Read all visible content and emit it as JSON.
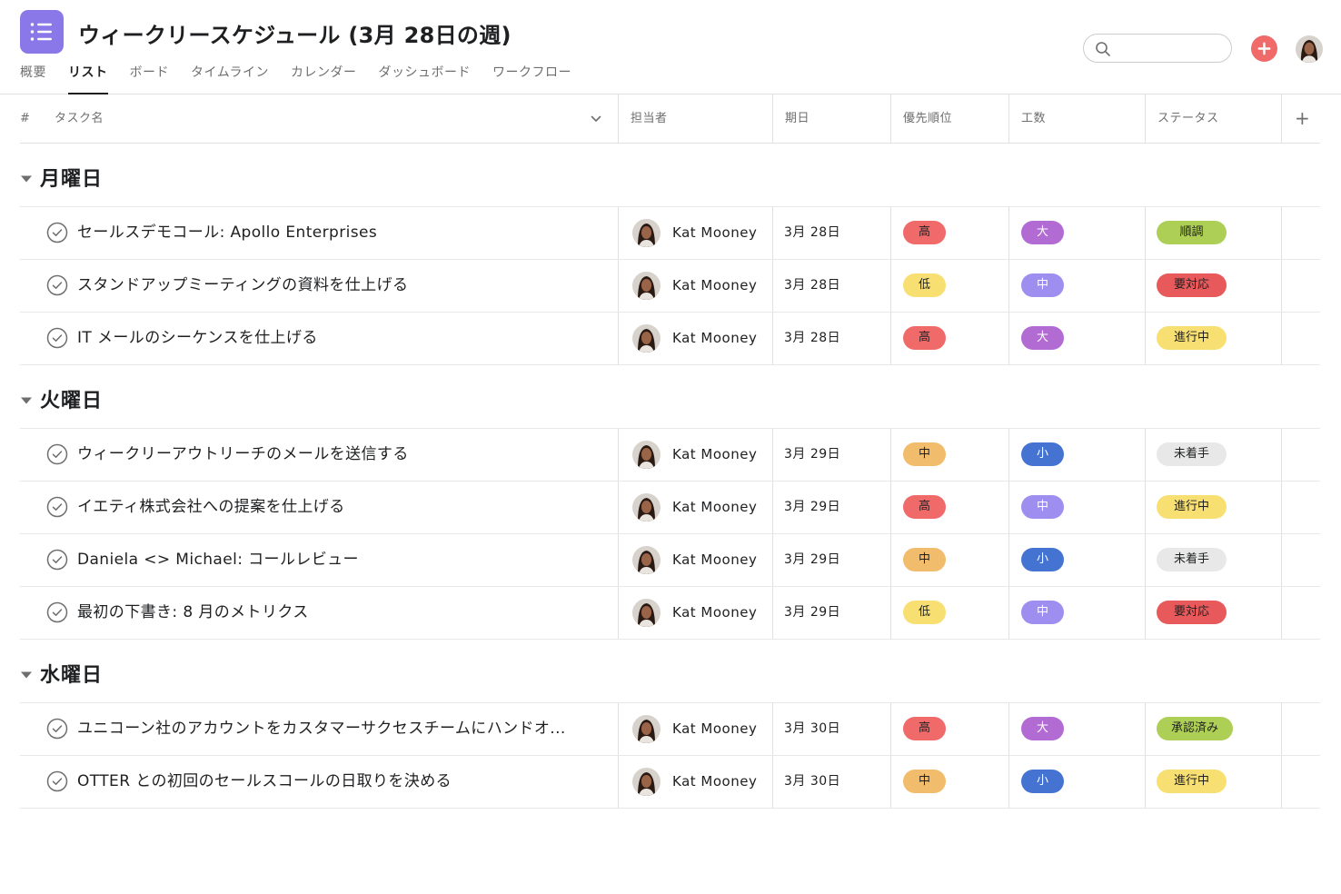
{
  "header": {
    "title": "ウィークリースケジュール (3月 28日の週)",
    "app_icon": "list-icon",
    "search_placeholder": "",
    "tabs": [
      "概要",
      "リスト",
      "ボード",
      "タイムライン",
      "カレンダー",
      "ダッシュボード",
      "ワークフロー"
    ],
    "active_tab": "リスト"
  },
  "columns": {
    "number": "#",
    "task": "タスク名",
    "assignee": "担当者",
    "due": "期日",
    "priority": "優先順位",
    "effort": "工数",
    "status": "ステータス",
    "add": "+"
  },
  "colors": {
    "high": "#f06a6a",
    "medium_priority": "#f1bd6c",
    "low": "#f8df72",
    "effort_large": "#b36bd4",
    "effort_medium": "#9e8ef0",
    "effort_small": "#4573d2",
    "status_on_track": "#aecf55",
    "status_action": "#e8595b",
    "status_in_progress": "#f8df72",
    "status_not_started": "#e8e8e8",
    "status_approved": "#aecf55",
    "accent": "#8a78e8"
  },
  "sections": [
    {
      "title": "月曜日",
      "rows": [
        {
          "task": "セールスデモコール: Apollo Enterprises",
          "assignee": "Kat Mooney",
          "due": "3月 28日",
          "priority": "高",
          "effort": "大",
          "status": "順調"
        },
        {
          "task": "スタンドアップミーティングの資料を仕上げる",
          "assignee": "Kat Mooney",
          "due": "3月 28日",
          "priority": "低",
          "effort": "中",
          "status": "要対応"
        },
        {
          "task": "IT メールのシーケンスを仕上げる",
          "assignee": "Kat Mooney",
          "due": "3月 28日",
          "priority": "高",
          "effort": "大",
          "status": "進行中"
        }
      ]
    },
    {
      "title": "火曜日",
      "rows": [
        {
          "task": "ウィークリーアウトリーチのメールを送信する",
          "assignee": "Kat Mooney",
          "due": "3月 29日",
          "priority": "中",
          "effort": "小",
          "status": "未着手"
        },
        {
          "task": "イエティ株式会社への提案を仕上げる",
          "assignee": "Kat Mooney",
          "due": "3月 29日",
          "priority": "高",
          "effort": "中",
          "status": "進行中"
        },
        {
          "task": "Daniela <> Michael: コールレビュー",
          "assignee": "Kat Mooney",
          "due": "3月 29日",
          "priority": "中",
          "effort": "小",
          "status": "未着手"
        },
        {
          "task": "最初の下書き: 8 月のメトリクス",
          "assignee": "Kat Mooney",
          "due": "3月 29日",
          "priority": "低",
          "effort": "中",
          "status": "要対応"
        }
      ]
    },
    {
      "title": "水曜日",
      "rows": [
        {
          "task": "ユニコーン社のアカウントをカスタマーサクセスチームにハンドオ...",
          "assignee": "Kat Mooney",
          "due": "3月 30日",
          "priority": "高",
          "effort": "大",
          "status": "承認済み"
        },
        {
          "task": "OTTER との初回のセールスコールの日取りを決める",
          "assignee": "Kat Mooney",
          "due": "3月 30日",
          "priority": "中",
          "effort": "小",
          "status": "進行中"
        }
      ]
    }
  ]
}
